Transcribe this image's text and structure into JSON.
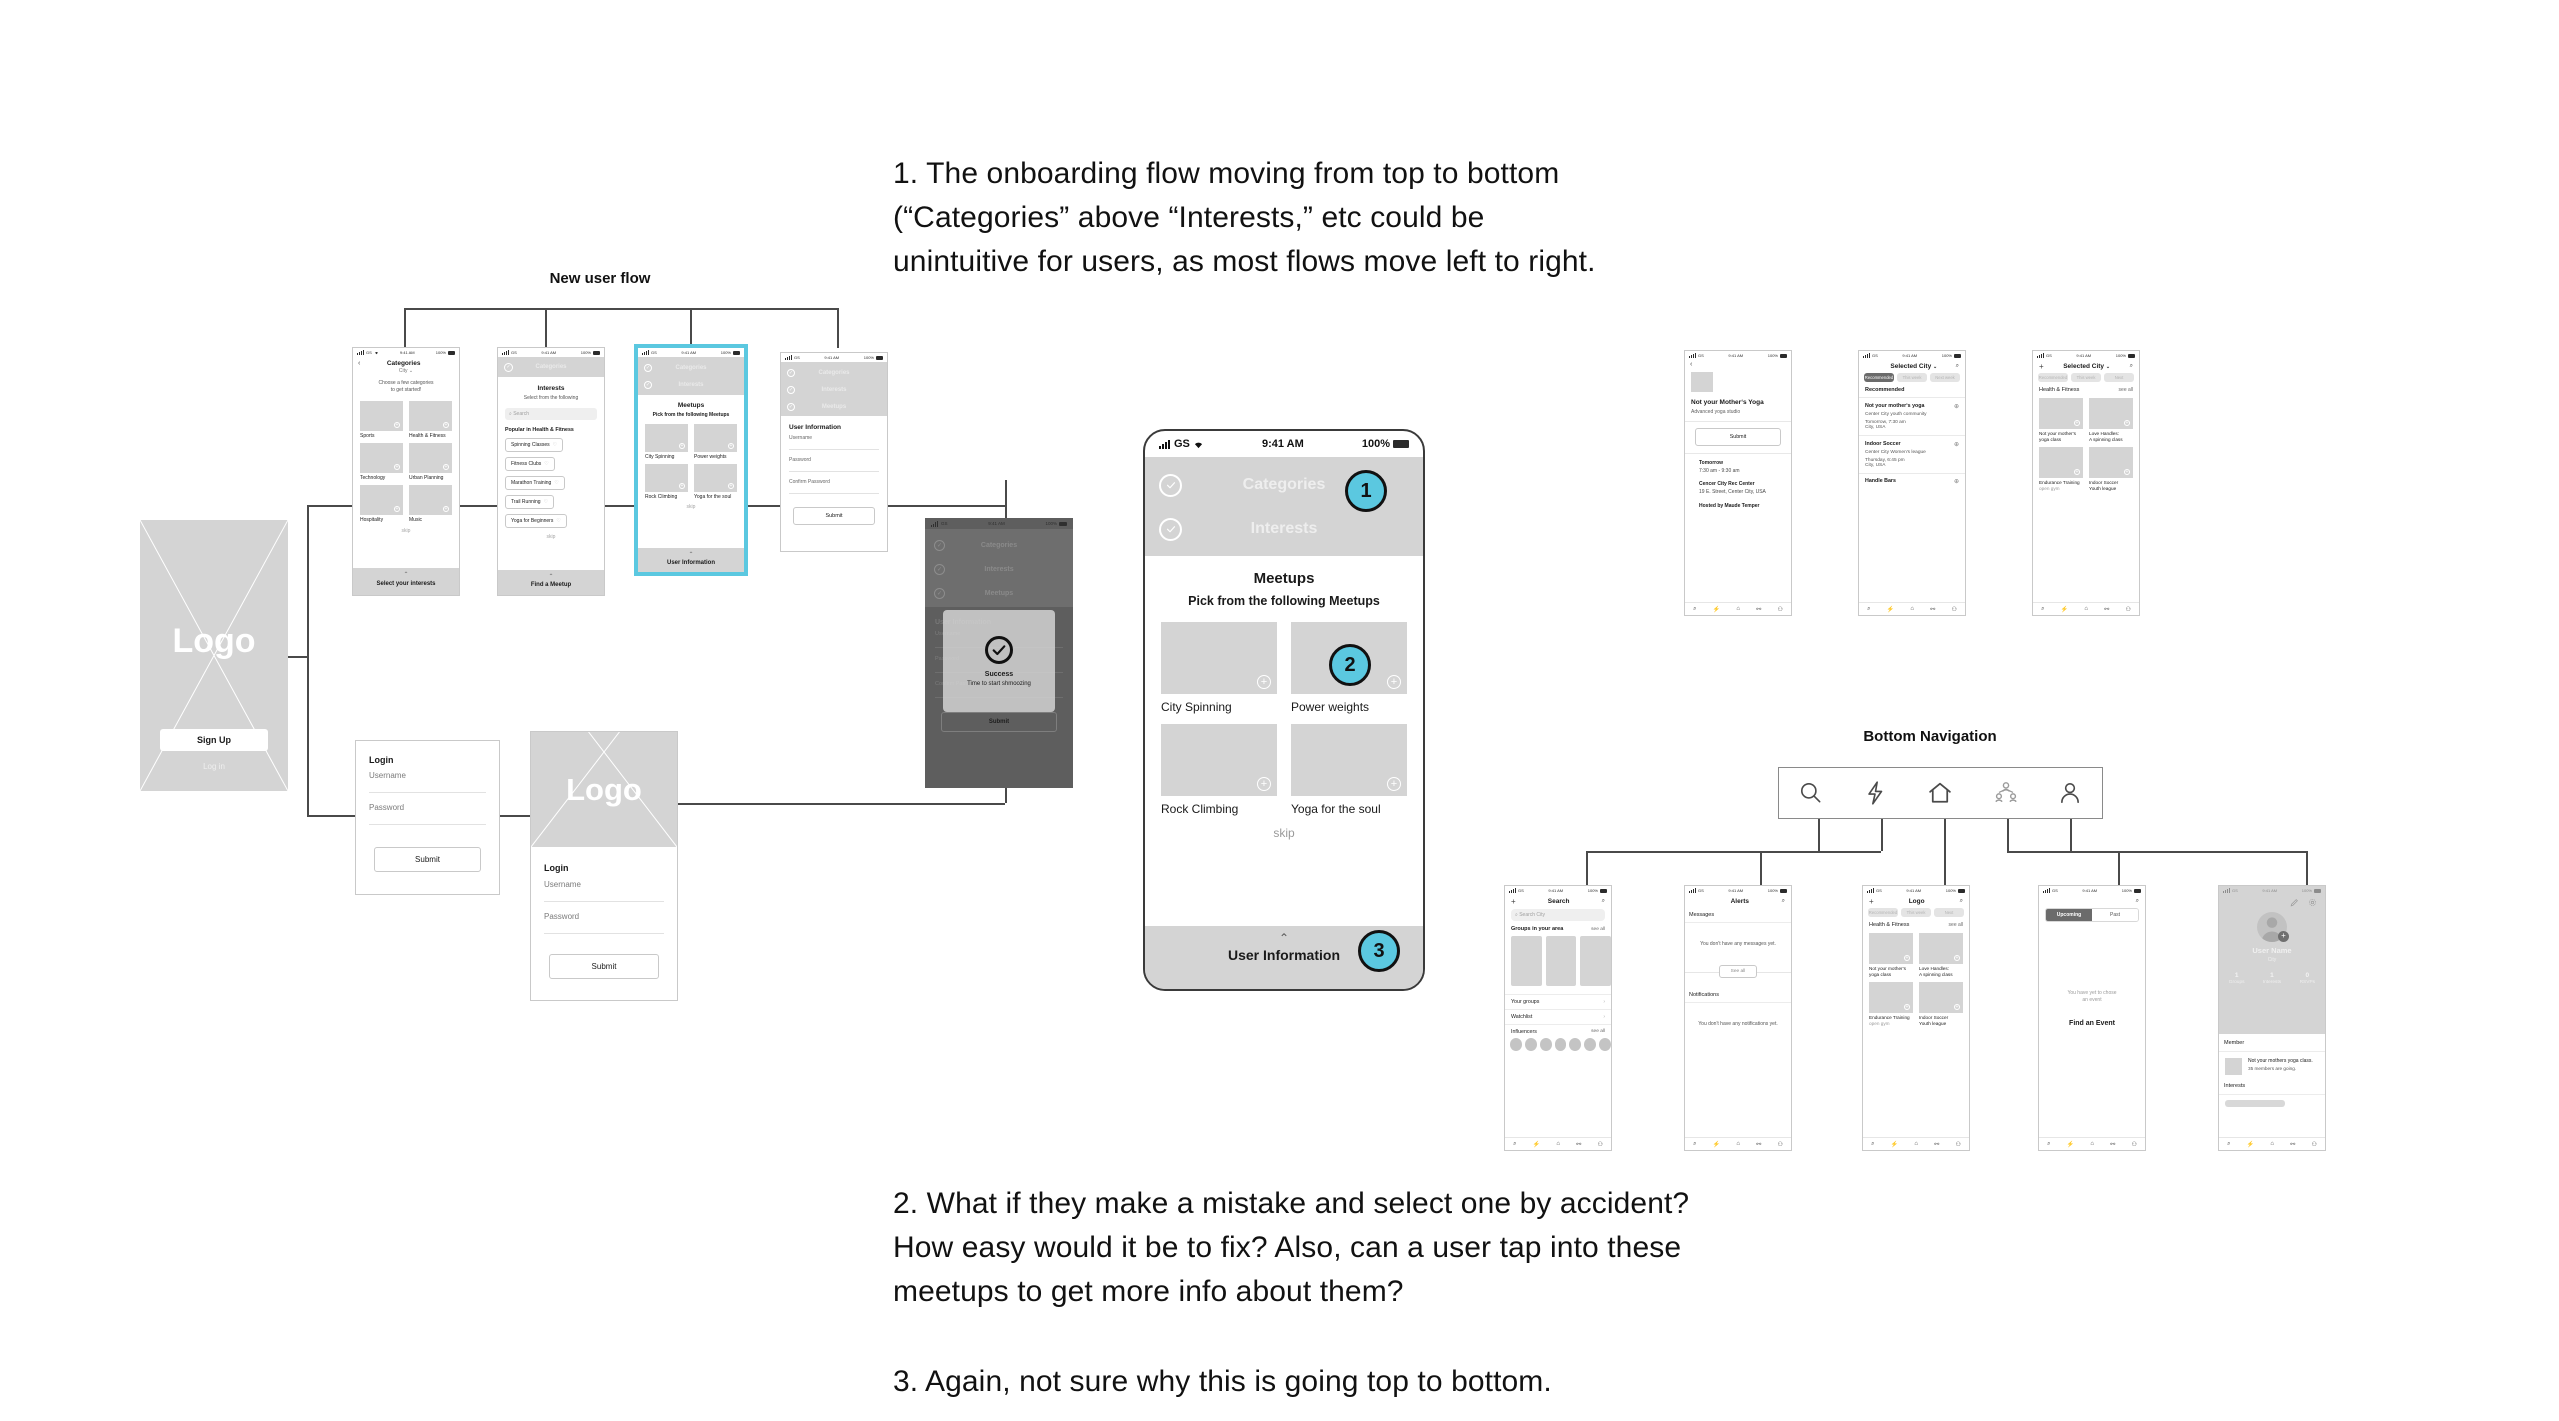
{
  "annotations": {
    "note1": "1. The onboarding flow moving from top to bottom\n(“Categories” above “Interests,” etc could be\nunintuitive for users, as most flows move left to right.",
    "note2": "2. What if they make a mistake and select one by accident?\nHow easy would it be to fix? Also, can a user tap into these\nmeetups to get more info about them?",
    "note3": "3. Again, not sure why this is going top to bottom."
  },
  "accent_color": "#5BC8E0",
  "flows": {
    "new_user_flow_title": "New user flow",
    "bottom_navigation_title": "Bottom Navigation"
  },
  "status_bar": {
    "carrier": "GS",
    "time": "9:41 AM",
    "battery": "100%"
  },
  "callouts": [
    {
      "number": "1"
    },
    {
      "number": "2"
    },
    {
      "number": "3"
    }
  ],
  "big_phone": {
    "steps": [
      {
        "label": "Categories",
        "state": "complete"
      },
      {
        "label": "Interests",
        "state": "complete"
      }
    ],
    "title": "Meetups",
    "subtitle": "Pick from the following Meetups",
    "cards": [
      {
        "label": "City Spinning",
        "add": "+"
      },
      {
        "label": "Power weights",
        "add": "+"
      },
      {
        "label": "Rock Climbing",
        "add": "+"
      },
      {
        "label": "Yoga for the soul",
        "add": "+"
      }
    ],
    "skip": "skip",
    "footer_chevron": "⌃",
    "footer_label": "User Information"
  },
  "splash": {
    "logo": "Logo",
    "signup": "Sign Up",
    "login": "Log in"
  },
  "login_card": {
    "title": "Login",
    "username": "Username",
    "password": "Password",
    "submit": "Submit"
  },
  "logo_login": {
    "logo": "Logo",
    "title": "Login",
    "username": "Username",
    "password": "Password",
    "submit": "Submit"
  },
  "categories_screen": {
    "back": "‹",
    "title": "Categories",
    "city": "City",
    "prompt": "Choose a few categories\nto get started!",
    "items": [
      "Sports",
      "Health & Fitness",
      "Technology",
      "Urban Planning",
      "Hospitality",
      "Music"
    ],
    "skip": "skip",
    "footer_label": "Select your interests"
  },
  "interests_screen": {
    "step": "Categories",
    "title": "Interests",
    "subtitle": "Select from the following",
    "search_placeholder": "Search",
    "section": "Popular in Health & Fitness",
    "tags": [
      "Spinning Classes",
      "Fitness Clubs",
      "Marathon Training",
      "Trail Running",
      "Yoga for Beginners"
    ],
    "skip": "skip",
    "footer_label": "Find a Meetup"
  },
  "meetups_small": {
    "steps": [
      "Categories",
      "Interests"
    ],
    "title": "Meetups",
    "subtitle": "Pick from the following Meetups",
    "cards": [
      "City Spinning",
      "Power weights",
      "Rock Climbing",
      "Yoga for the soul"
    ],
    "skip": "skip",
    "footer_label": "User Information"
  },
  "userinfo_screen": {
    "steps": [
      "Categories",
      "Interests",
      "Meetups"
    ],
    "title": "User Information",
    "fields": [
      "Username",
      "Password",
      "Confirm Password"
    ],
    "submit": "Submit"
  },
  "success_screen": {
    "steps": [
      "Categories",
      "Interests",
      "Meetups"
    ],
    "title": "User Information",
    "fields": [
      "Username",
      "Password",
      "Confirm Password"
    ],
    "submit": "Submit",
    "modal_title": "Success",
    "modal_sub": "Time to start shmoozing"
  },
  "event_detail": {
    "back": "‹",
    "title": "Not your Mother‘s Yoga",
    "subtitle": "Advanced yoga studio",
    "submit": "Submit",
    "when_label": "Tomorrow",
    "when_time": "7:30 am - 9:30 am",
    "venue": "Cencer City Rec Center",
    "address": "19 E. Street, Center City, USA",
    "host": "Hosted by Maude Temper"
  },
  "recommended_screen": {
    "title": "Selected City",
    "chips": [
      "Recommended",
      "This week",
      "Next week"
    ],
    "section": "Recommended",
    "rows": [
      {
        "name": "Not your mother‘s yoga",
        "group": "Center City youth community",
        "time": "Tomorrow, 7:30 am",
        "place": "City, USA",
        "add": "+"
      },
      {
        "name": "Indoor Soccer",
        "group": "Center City Women's league",
        "time": "Thursday, 6:45 pm",
        "place": "City, USA",
        "add": "+"
      },
      {
        "name": "Handle Bars",
        "group": "",
        "time": "",
        "place": "",
        "add": "+"
      }
    ]
  },
  "health_fitness_screen": {
    "plus": "+",
    "title": "Selected City",
    "chips": [
      "Recommended",
      "This week",
      "Next"
    ],
    "section": "Health & Fitness",
    "see_all": "see all",
    "cards": [
      {
        "line1": "Not your mother‘s",
        "line2": "yoga class"
      },
      {
        "line1": "Love Handles:",
        "line2": "A spinning class"
      },
      {
        "line1": "Endurance Training",
        "line2": "open gym"
      },
      {
        "line1": "Indoor Soccer",
        "line2": "Youth league"
      }
    ]
  },
  "bottom_nav_icons": [
    "search-icon",
    "bolt-icon",
    "home-icon",
    "group-icon",
    "person-icon"
  ],
  "search_screen": {
    "plus": "+",
    "title": "Search",
    "search_placeholder": "Search City",
    "section": "Groups in your area",
    "see_all": "see all",
    "rows": [
      {
        "label": "Your groups",
        "chevron": "›"
      },
      {
        "label": "Watchlist",
        "chevron": "›"
      }
    ],
    "influencers_label": "Influencers",
    "influencers_see_all": "see all"
  },
  "alerts_screen": {
    "title": "Alerts",
    "messages_label": "Messages",
    "messages_empty": "You don't have any messages yet.",
    "see_all": "See all",
    "notifications_label": "Notifications",
    "notifications_empty": "You don't have any notifications yet."
  },
  "logo_home_screen": {
    "plus": "+",
    "title": "Logo",
    "chips": [
      "Recommended",
      "This week",
      "Next"
    ],
    "section": "Health & Fitness",
    "see_all": "see all",
    "cards": [
      {
        "line1": "Not your mother‘s",
        "line2": "yoga class"
      },
      {
        "line1": "Love Handles:",
        "line2": "A spinning class"
      },
      {
        "line1": "Endurance Training",
        "line2": "open gym"
      },
      {
        "line1": "Indoor Soccer",
        "line2": "Youth league"
      }
    ]
  },
  "events_screen": {
    "tabs": [
      "Upcoming",
      "Past"
    ],
    "empty": "You have yet to chose\nan event",
    "cta": "Find an Event"
  },
  "profile_screen": {
    "name": "User Name",
    "city": "City",
    "stats": [
      {
        "value": "1",
        "label": "Groups"
      },
      {
        "value": "1",
        "label": "Interests"
      },
      {
        "value": "0",
        "label": "RSVPs"
      }
    ],
    "member_label": "Member",
    "member_item": "Not your mothers yoga class.",
    "member_sub": "35 members are going.",
    "interests_label": "Interests"
  }
}
